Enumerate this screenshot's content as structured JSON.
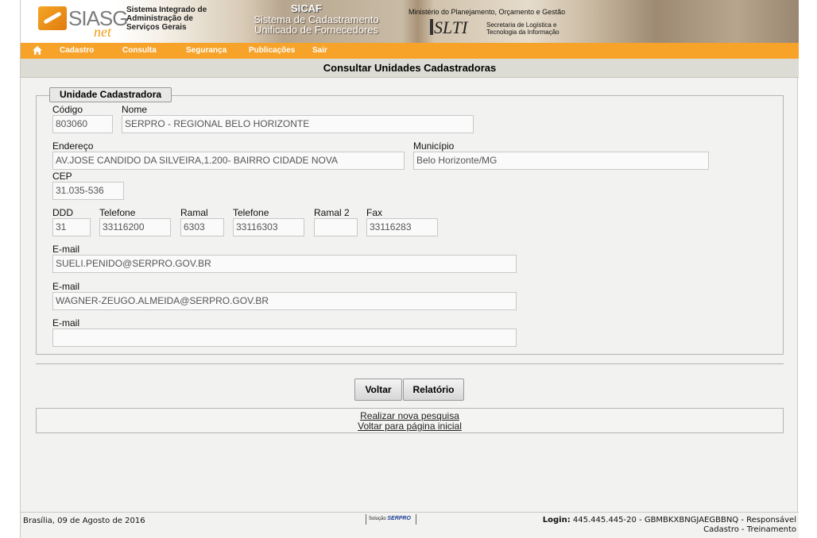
{
  "header": {
    "logo_main": "SIASG",
    "logo_suffix": "net",
    "system_name": "Sistema Integrado de Administração de Serviços Gerais",
    "sicaf_code": "SICAF",
    "sicaf_name": "Sistema de Cadastramento Unificado de Fornecedores",
    "ministry": "Ministério do Planejamento, Orçamento e Gestão",
    "slti_logo": "SLTI",
    "slti_name": "Secretaria de Logística e Tecnologia da Informação"
  },
  "menu": {
    "home_icon": "home-icon",
    "items": [
      "Cadastro",
      "Consulta",
      "Segurança",
      "Publicações",
      "Sair"
    ]
  },
  "page_title": "Consultar Unidades Cadastradoras",
  "form": {
    "legend": "Unidade Cadastradora",
    "codigo_label": "Código",
    "codigo": "803060",
    "nome_label": "Nome",
    "nome": "SERPRO - REGIONAL BELO HORIZONTE",
    "endereco_label": "Endereço",
    "endereco": "AV.JOSE CANDIDO DA SILVEIRA,1.200- BAIRRO CIDADE NOVA",
    "municipio_label": "Município",
    "municipio": "Belo Horizonte/MG",
    "cep_label": "CEP",
    "cep": "31.035-536",
    "ddd_label": "DDD",
    "ddd": "31",
    "telefone1_label": "Telefone",
    "telefone1": "33116200",
    "ramal1_label": "Ramal",
    "ramal1": "6303",
    "telefone2_label": "Telefone",
    "telefone2": "33116303",
    "ramal2_label": "Ramal 2",
    "ramal2": "",
    "fax_label": "Fax",
    "fax": "33116283",
    "email1_label": "E-mail",
    "email1": "SUELI.PENIDO@SERPRO.GOV.BR",
    "email2_label": "E-mail",
    "email2": "WAGNER-ZEUGO.ALMEIDA@SERPRO.GOV.BR",
    "email3_label": "E-mail",
    "email3": ""
  },
  "buttons": {
    "voltar": "Voltar",
    "relatorio": "Relatório"
  },
  "links": {
    "nova_pesquisa": "Realizar nova pesquisa",
    "pagina_inicial": "Voltar para página inicial"
  },
  "footer": {
    "date": "Brasília, 09 de Agosto de 2016",
    "solucao": "Solução",
    "serpro": "SERPRO",
    "login_label": "Login:",
    "login_value": "445.445.445-20 - GBMBKXBNGJAEGBBNQ - Responsável Cadastro - Treinamento"
  }
}
